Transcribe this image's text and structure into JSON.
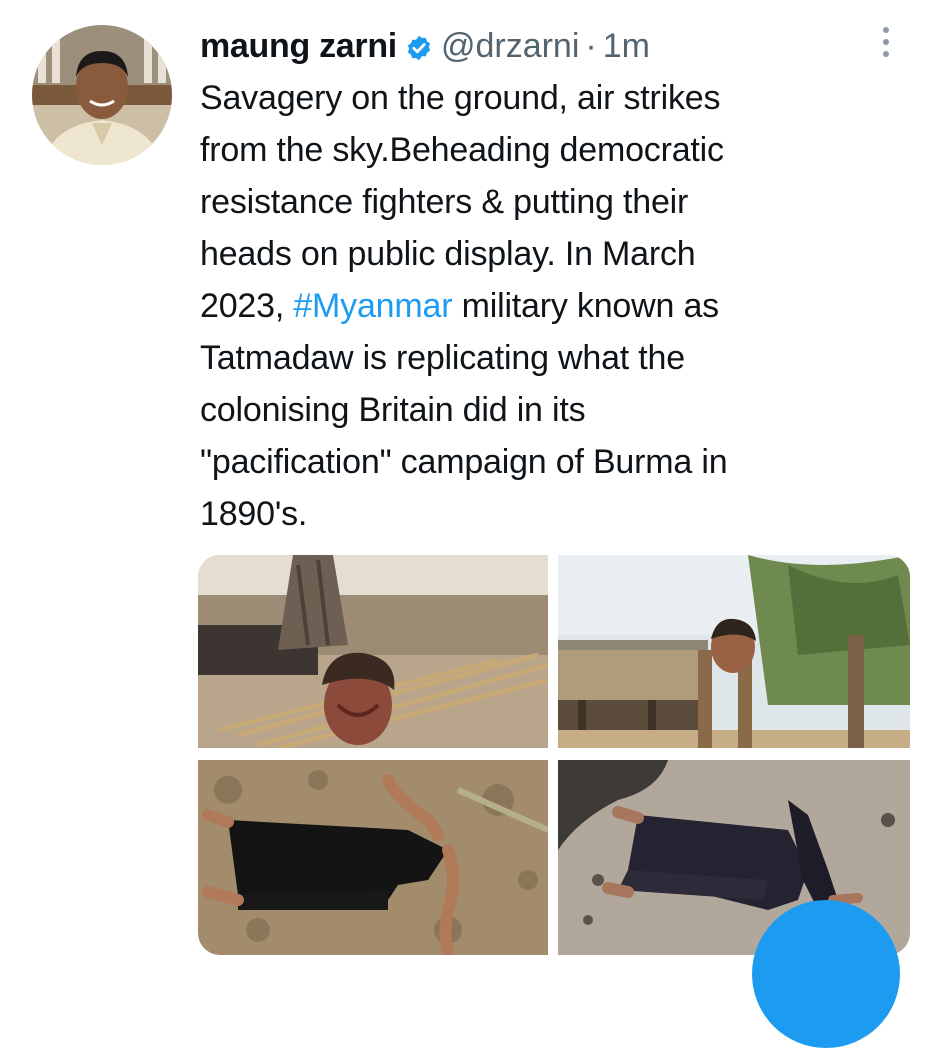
{
  "tweet": {
    "author_name": "maung zarni",
    "handle": "@drzarni",
    "separator": "·",
    "time": "1m",
    "text_lines": [
      "Savagery on the ground, air strikes",
      "from the sky.Beheading democratic",
      "resistance fighters & putting their",
      "heads on public display.  In March",
      "2023,",
      "#Myanmar",
      "military known as",
      "Tatmadaw is replicating what the",
      "colonising Britain did in its",
      "\"pacification\" campaign of Burma in",
      "1890's."
    ]
  },
  "icons": {
    "verified": "verified-badge-icon",
    "more": "more-options-icon",
    "compose": "compose-fab"
  },
  "colors": {
    "text": "#0f1419",
    "secondary": "#536471",
    "accent": "#1d9bf0"
  }
}
